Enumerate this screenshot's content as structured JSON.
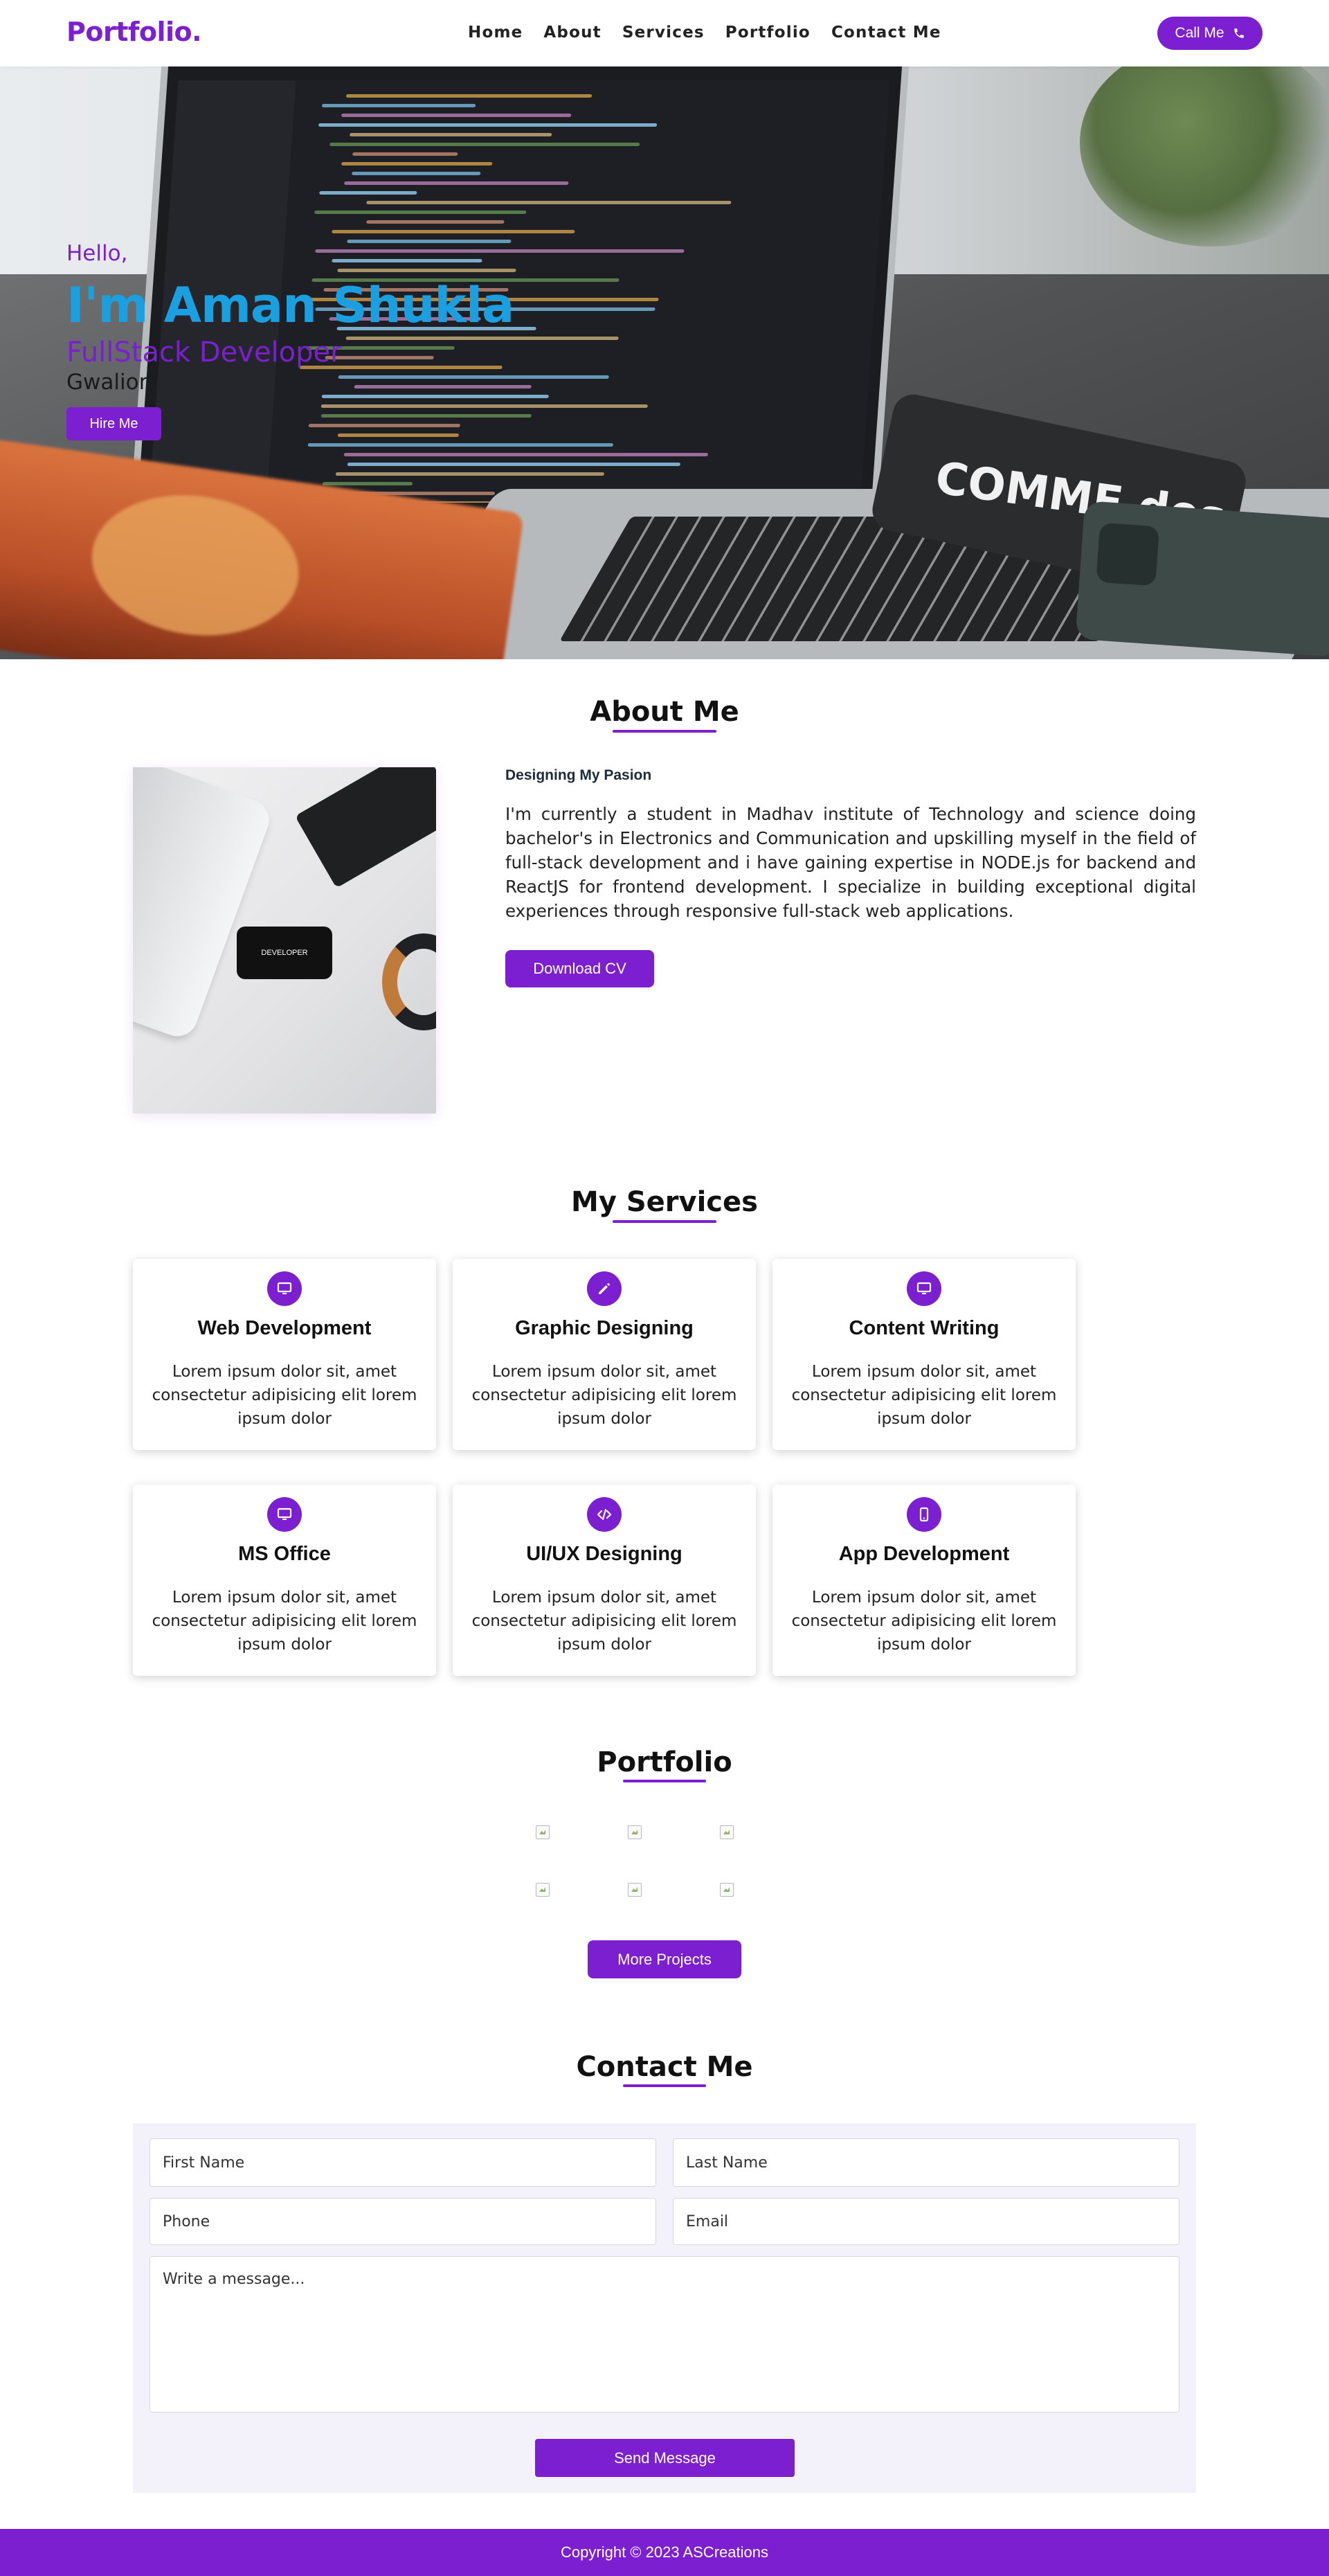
{
  "nav": {
    "logo": "Portfolio.",
    "links": [
      "Home",
      "About",
      "Services",
      "Portfolio",
      "Contact Me"
    ],
    "call_label": "Call Me",
    "call_icon": "phone-icon"
  },
  "hero": {
    "greeting": "Hello,",
    "name": "I'm Aman Shukla",
    "role": "FullStack Developer",
    "location": "Gwalior",
    "hire_label": "Hire Me",
    "pouch_text": "COMME des",
    "phone_screen_text": "DEVELOPER"
  },
  "about": {
    "title": "About Me",
    "subtitle": "Designing My Pasion",
    "description": "I'm currently a student in Madhav institute of Technology and science doing bachelor's in Electronics and Communication and upskilling myself in the field of full-stack development and i have gaining expertise in NODE.js for backend and ReactJS for frontend development. I specialize in building exceptional digital experiences through responsive full-stack web applications.",
    "cv_label": "Download CV"
  },
  "services": {
    "title": "My Services",
    "items": [
      {
        "title": "Web Development",
        "desc": "Lorem ipsum dolor sit, amet consectetur adipisicing elit lorem ipsum dolor",
        "icon": "monitor-icon"
      },
      {
        "title": "Graphic Designing",
        "desc": "Lorem ipsum dolor sit, amet consectetur adipisicing elit lorem ipsum dolor",
        "icon": "pencil-icon"
      },
      {
        "title": "Content Writing",
        "desc": "Lorem ipsum dolor sit, amet consectetur adipisicing elit lorem ipsum dolor",
        "icon": "monitor-icon"
      },
      {
        "title": "MS Office",
        "desc": "Lorem ipsum dolor sit, amet consectetur adipisicing elit lorem ipsum dolor",
        "icon": "monitor-icon"
      },
      {
        "title": "UI/UX Designing",
        "desc": "Lorem ipsum dolor sit, amet consectetur adipisicing elit lorem ipsum dolor",
        "icon": "code-icon"
      },
      {
        "title": "App Development",
        "desc": "Lorem ipsum dolor sit, amet consectetur adipisicing elit lorem ipsum dolor",
        "icon": "mobile-icon"
      }
    ]
  },
  "portfolio": {
    "title": "Portfolio",
    "more_label": "More Projects"
  },
  "contact": {
    "title": "Contact Me",
    "first_name_placeholder": "First Name",
    "last_name_placeholder": "Last Name",
    "phone_placeholder": "Phone",
    "email_placeholder": "Email",
    "message_placeholder": "Write a message...",
    "send_label": "Send Message"
  },
  "footer": {
    "copyright": "Copyright © 2023 ASCreations"
  },
  "colors": {
    "accent": "#7b1fd0",
    "name_blue": "#1aa0e0",
    "contact_bg": "#f3f2fb"
  }
}
